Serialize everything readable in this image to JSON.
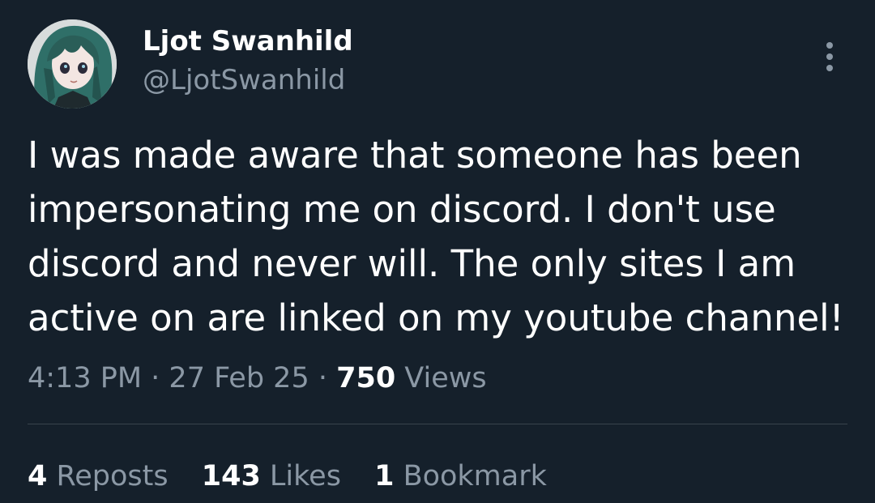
{
  "author": {
    "display_name": "Ljot Swanhild",
    "handle": "@LjotSwanhild",
    "avatar_icon": "anime-avatar-icon"
  },
  "tweet": {
    "text": "I was made aware that someone has been\nimpersonating me on discord. I don't use\ndiscord and never will. The only sites I am\nactive on are linked on my youtube channel!"
  },
  "meta": {
    "time": "4:13 PM",
    "separator": " · ",
    "date": "27 Feb 25",
    "views_count": "750",
    "views_label": " Views"
  },
  "stats": {
    "reposts_count": "4",
    "reposts_label": " Reposts",
    "likes_count": "143",
    "likes_label": " Likes",
    "bookmarks_count": "1",
    "bookmarks_label": " Bookmark"
  },
  "colors": {
    "background": "#15202b",
    "primary_text": "#ffffff",
    "secondary_text": "#8b98a5",
    "divider": "#38444d"
  }
}
